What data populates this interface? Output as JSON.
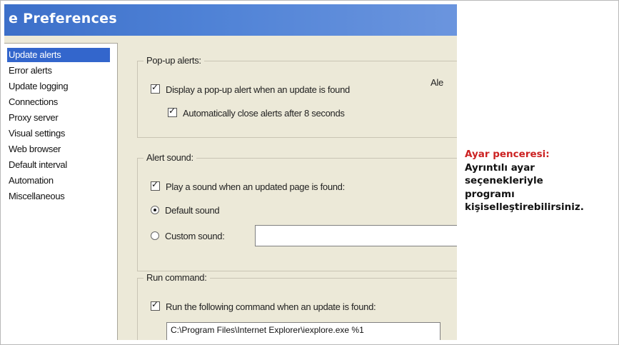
{
  "window": {
    "title": "e Preferences"
  },
  "sidebar": {
    "items": [
      {
        "label": "Update alerts",
        "selected": true
      },
      {
        "label": "Error alerts"
      },
      {
        "label": "Update logging"
      },
      {
        "label": "Connections"
      },
      {
        "label": "Proxy server"
      },
      {
        "label": "Visual settings"
      },
      {
        "label": "Web browser"
      },
      {
        "label": "Default interval"
      },
      {
        "label": "Automation"
      },
      {
        "label": "Miscellaneous"
      }
    ]
  },
  "popup_alerts": {
    "title": "Pop-up alerts:",
    "display_popup": {
      "label": "Display a pop-up alert when an update is found",
      "checked": true
    },
    "auto_close": {
      "label": "Automatically close alerts after 8 seconds",
      "checked": true
    },
    "side_label": "Ale"
  },
  "alert_sound": {
    "title": "Alert sound:",
    "play_sound": {
      "label": "Play a sound when an updated page is found:",
      "checked": true
    },
    "default_sound": {
      "label": "Default sound",
      "selected": true
    },
    "custom_sound": {
      "label": "Custom sound:",
      "selected": false,
      "value": ""
    }
  },
  "run_command": {
    "title": "Run command:",
    "run_following": {
      "label": "Run the following command when an update is found:",
      "checked": true
    },
    "command_value": "C:\\Program Files\\Internet Explorer\\iexplore.exe %1"
  },
  "caption": {
    "heading": "Ayar penceresi:",
    "lines": [
      "Ayrıntılı ayar",
      "seçenekleriyle",
      "programı",
      "kişiselleştirebilirsiniz."
    ]
  },
  "colors": {
    "titlebar": "#3c6fc9",
    "selection": "#3366cc",
    "caption_heading": "#cc2222"
  },
  "checkmark_glyph": "✓",
  "radio_glyph": "•"
}
